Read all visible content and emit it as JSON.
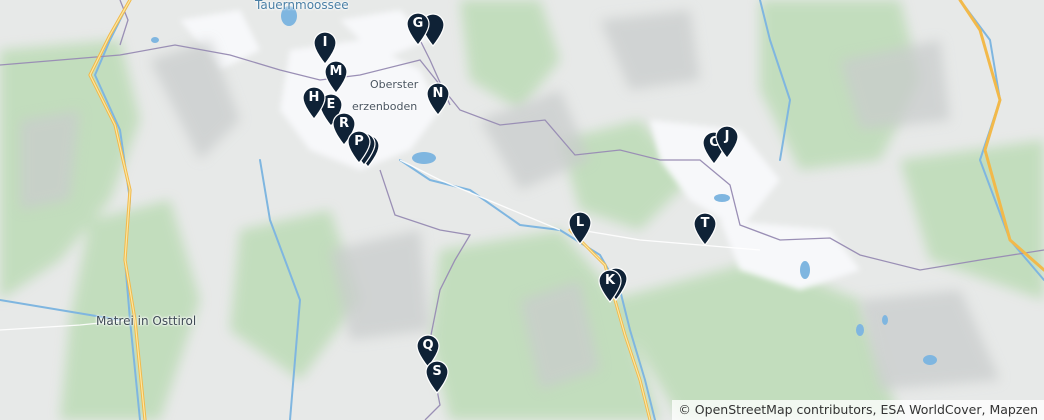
{
  "map": {
    "place_labels": {
      "tauernmoossee": "Tauernmoossee",
      "oberster_line1": "Oberster",
      "oberster_line2": "erzenboden",
      "matrei": "Matrei in Osttirol"
    },
    "colors": {
      "pin": "#0f2236",
      "pin_text": "#ffffff",
      "route": "#f4c84d",
      "boundary": "#8b7fa8",
      "water": "#7fb6e0",
      "vegetation": "#b9d9b4",
      "glacier": "#f4f5f7"
    },
    "markers": [
      {
        "letter": "G"
      },
      {
        "letter": "I"
      },
      {
        "letter": "M"
      },
      {
        "letter": "N"
      },
      {
        "letter": "H"
      },
      {
        "letter": "E"
      },
      {
        "letter": "R"
      },
      {
        "letter": "P"
      },
      {
        "letter": "C"
      },
      {
        "letter": "J"
      },
      {
        "letter": "L"
      },
      {
        "letter": "T"
      },
      {
        "letter": "K"
      },
      {
        "letter": "Q"
      },
      {
        "letter": "S"
      }
    ],
    "attribution": "© OpenStreetMap contributors, ESA WorldCover, Mapzen"
  }
}
